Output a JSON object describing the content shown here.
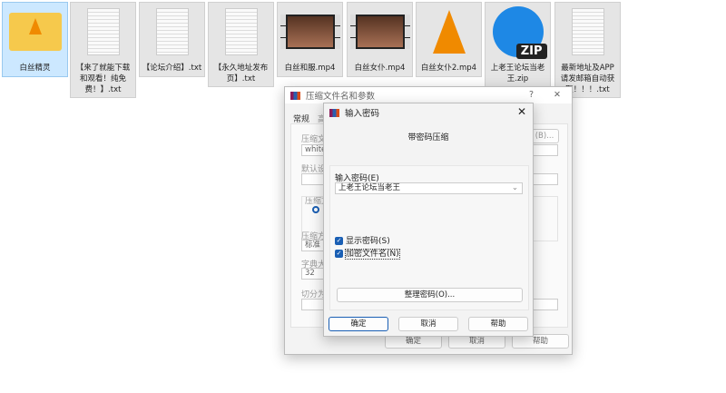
{
  "files": [
    {
      "name": "白丝精灵",
      "type": "folder",
      "selected": true
    },
    {
      "name": "【来了就能下载和观看！纯免费！】.txt",
      "type": "txt"
    },
    {
      "name": "【论坛介绍】.txt",
      "type": "txt"
    },
    {
      "name": "【永久地址发布页】.txt",
      "type": "txt"
    },
    {
      "name": "白丝和服.mp4",
      "type": "video"
    },
    {
      "name": "白丝女仆.mp4",
      "type": "video"
    },
    {
      "name": "白丝女仆2.mp4",
      "type": "vlc"
    },
    {
      "name": "上老王论坛当老王.zip",
      "type": "zip"
    },
    {
      "name": "最新地址及APP请发邮箱自动获取！！！.txt",
      "type": "txt"
    }
  ],
  "back_dialog": {
    "title": "压缩文件名和参数",
    "help": "?",
    "close": "✕",
    "tab_general": "常规",
    "tab_2": "高",
    "archive_name_label": "压缩文",
    "archive_name_value": "white.r",
    "browse": "(B)...",
    "profile_label": "默认设",
    "format_label": "压缩文",
    "compression_label": "压缩方",
    "compression_value": "标准",
    "dict_label": "字典大",
    "dict_value": "32",
    "split_label": "切分为",
    "ok": "确定",
    "cancel": "取消",
    "help_btn": "帮助"
  },
  "password_dialog": {
    "title": "输入密码",
    "close": "✕",
    "heading": "带密码压缩",
    "password_label": "输入密码(E)",
    "password_value": "上老王论坛当老王",
    "show_password": "显示密码(S)",
    "show_password_checked": true,
    "encrypt_names": "加密文件名(N)",
    "encrypt_names_checked": true,
    "organize": "整理密码(O)...",
    "ok": "确定",
    "cancel": "取消",
    "help": "帮助"
  }
}
